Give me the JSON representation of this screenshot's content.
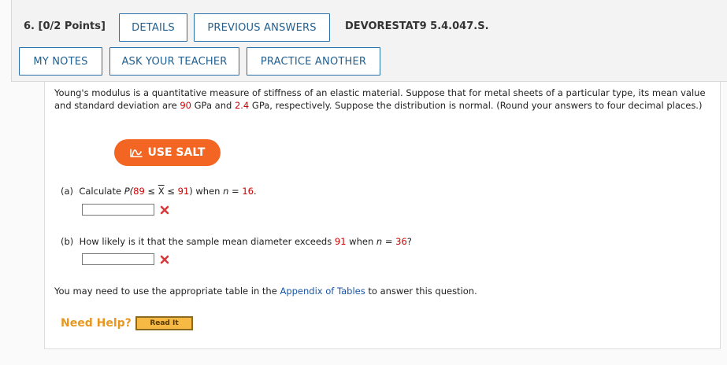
{
  "header": {
    "question_number": "6.",
    "points": "[0/2 Points]",
    "details_label": "DETAILS",
    "previous_answers_label": "PREVIOUS ANSWERS",
    "problem_code": "DEVORESTAT9 5.4.047.S.",
    "my_notes_label": "MY NOTES",
    "ask_teacher_label": "ASK YOUR TEACHER",
    "practice_another_label": "PRACTICE ANOTHER"
  },
  "problem": {
    "intro_1": "Young's modulus is a quantitative measure of stiffness of an elastic material. Suppose that for metal sheets of a particular type, its mean value and standard deviation are ",
    "mean": "90",
    "intro_2": " GPa and ",
    "sd": "2.4",
    "intro_3": " GPa, respectively. Suppose the distribution is normal. (Round your answers to four decimal places.)"
  },
  "salt": {
    "label": "USE SALT",
    "color": "#f26522"
  },
  "part_a": {
    "label": "(a)",
    "text_1": "Calculate ",
    "p_open": "P(",
    "low": "89",
    "leq1": " ≤ ",
    "xbar": "X",
    "leq2": " ≤ ",
    "high": "91",
    "p_close": ")",
    "when": " when ",
    "n_var": "n",
    "equals": " = ",
    "n_value": "16",
    "period": ".",
    "answer_value": ""
  },
  "part_b": {
    "label": "(b)",
    "text_1": "How likely is it that the sample mean diameter exceeds ",
    "threshold": "91",
    "when": " when ",
    "n_var": "n",
    "equals": " = ",
    "n_value": "36",
    "qmark": "?",
    "answer_value": ""
  },
  "appendix_note": {
    "text_1": "You may need to use the appropriate table in the ",
    "link": "Appendix of Tables",
    "text_2": " to answer this question."
  },
  "help": {
    "need_help_label": "Need Help?",
    "read_it_label": "Read It"
  },
  "colors": {
    "accent_blue": "#215f8f",
    "value_red": "#cc0000",
    "incorrect_red": "#d63a3a",
    "help_orange": "#e8961e"
  }
}
